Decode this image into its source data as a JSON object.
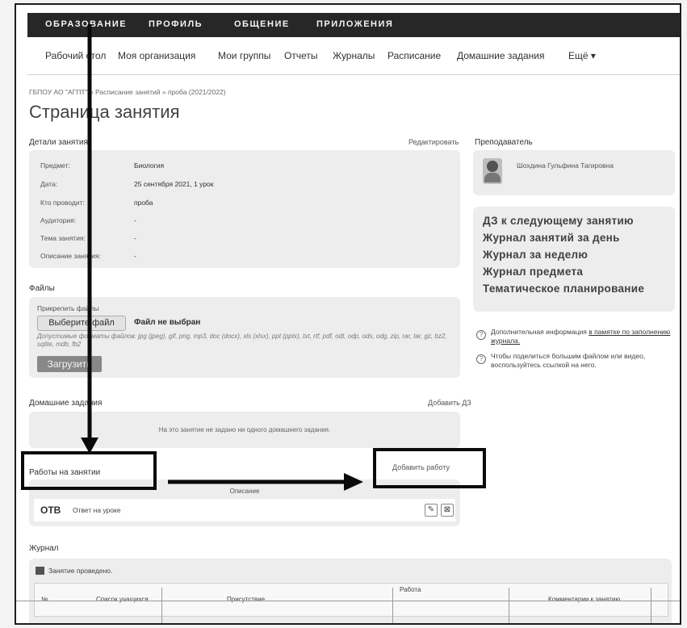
{
  "top_nav": [
    "ОБРАЗОВАНИЕ",
    "ПРОФИЛЬ",
    "ОБЩЕНИЕ",
    "ПРИЛОЖЕНИЯ"
  ],
  "sub_nav": [
    "Рабочий стол",
    "Моя организация",
    "Мои группы",
    "Отчеты",
    "Журналы",
    "Расписание",
    "Домашние задания",
    "Ещё ▾"
  ],
  "breadcrumb": "ГБПОУ АО \"АГПТ\" » Расписание занятий » проба (2021/2022)",
  "page_title": "Страница занятия",
  "details": {
    "heading": "Детали занятия",
    "edit_link": "Редактировать",
    "rows": [
      {
        "label": "Предмет:",
        "value": "Биология"
      },
      {
        "label": "Дата:",
        "value": "25 сентября 2021, 1 урок"
      },
      {
        "label": "Кто проводит:",
        "value": "проба"
      },
      {
        "label": "Аудитория:",
        "value": "-"
      },
      {
        "label": "Тема занятия:",
        "value": "-"
      },
      {
        "label": "Описание занятия:",
        "value": "-"
      }
    ]
  },
  "teacher": {
    "heading": "Преподаватель",
    "name": "Шохдина Гульфина Тагировна"
  },
  "dz_links": [
    "ДЗ к следующему занятию",
    "Журнал занятий за день",
    "Журнал за неделю",
    "Журнал предмета",
    "Тематическое планирование"
  ],
  "info_notes": {
    "note1_text": "Дополнительная информация ",
    "note1_link": "в памятке по заполнению журнала.",
    "note2": "Чтобы поделиться большим файлом или видео, воспользуйтесь ссылкой на него."
  },
  "files": {
    "heading": "Файлы",
    "attach_label": "Прикрепить файлы",
    "choose_button": "Выберите файл",
    "no_file": "Файл не выбран",
    "formats": "Допустимые форматы файлов: jpg (jpeg), gif, png, mp3, doc (docx), xls (xlsx), ppt (pptx), txt, rtf, pdf, odt, odp, ods, odg, zip, rar, tar, gz, bz2, sqlite, mdb, fb2",
    "upload_button": "Загрузить"
  },
  "homework": {
    "heading": "Домашние задания",
    "add_link": "Добавить ДЗ",
    "empty_text": "На это занятие не задано ни одного домашнего задания."
  },
  "works": {
    "heading": "Работы на занятии",
    "add_link": "Добавить работу",
    "column": "Описание",
    "row_code": "ОТВ",
    "row_desc": "Ответ на уроке"
  },
  "journal": {
    "heading": "Журнал",
    "status": "Занятие проведено.",
    "columns": [
      "№",
      "Список учащихся",
      "Присутствие",
      "Работа",
      "Комментарии к занятию"
    ]
  }
}
